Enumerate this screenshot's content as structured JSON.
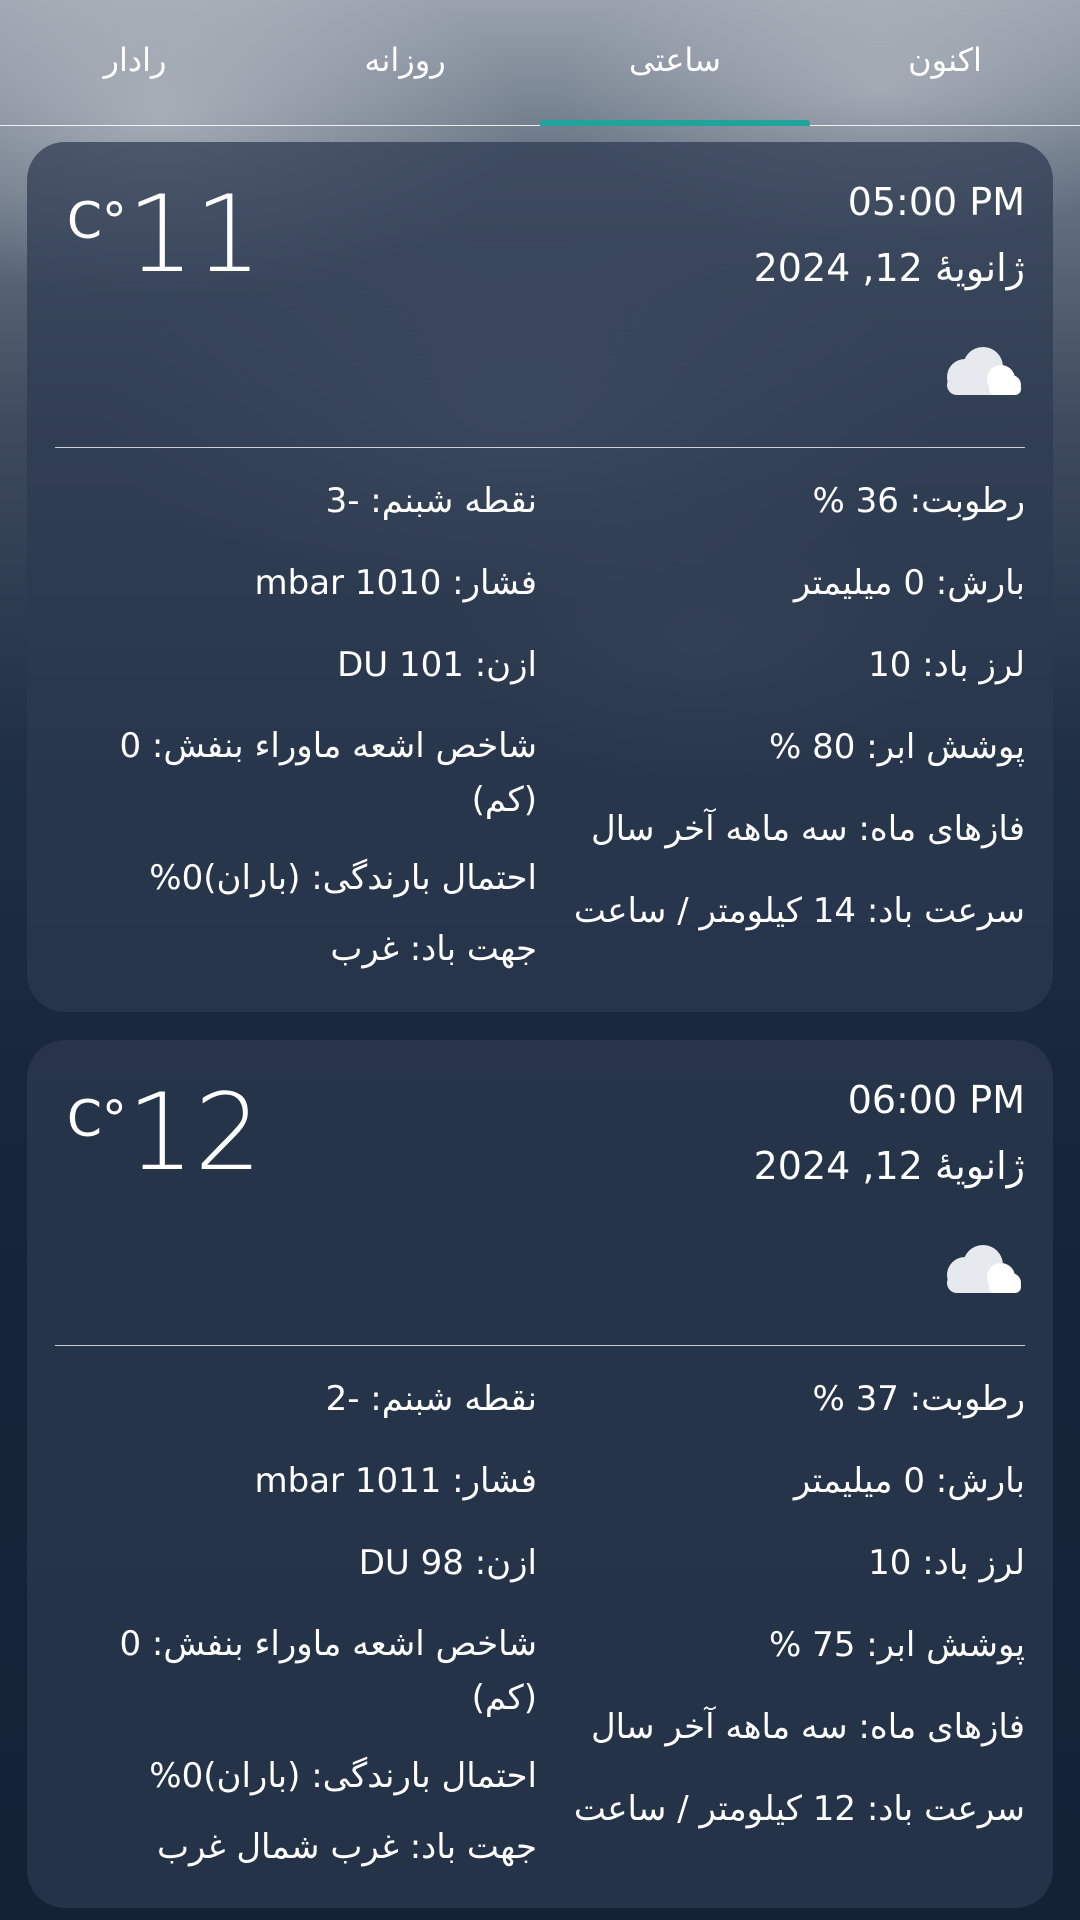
{
  "tabs": [
    {
      "label": "اکنون",
      "active": false
    },
    {
      "label": "ساعتی",
      "active": true
    },
    {
      "label": "روزانه",
      "active": false
    },
    {
      "label": "رادار",
      "active": false
    }
  ],
  "accent_color": "#1fa39a",
  "cards": [
    {
      "time": "05:00 PM",
      "date": "ژانویهٔ 12, 2024",
      "temperature": "11",
      "unit": "C°",
      "icon": "cloud-icon",
      "right_col": [
        "رطوبت: 36 %",
        "بارش: 0 میلیمتر",
        "لرز باد: 10",
        "پوشش ابر: 80 %",
        "فازهای ماه: سه ماهه آخر سال",
        "سرعت باد: 14 کیلومتر / ساعت"
      ],
      "left_col": [
        "نقطه شبنم: -3",
        "فشار: 1010 mbar",
        "ازن: 101 DU",
        "شاخص اشعه ماوراء بنفش: 0 (کم)",
        "احتمال بارندگی: (باران)0%",
        "جهت باد: غرب"
      ]
    },
    {
      "time": "06:00 PM",
      "date": "ژانویهٔ 12, 2024",
      "temperature": "12",
      "unit": "C°",
      "icon": "cloud-icon",
      "right_col": [
        "رطوبت: 37 %",
        "بارش: 0 میلیمتر",
        "لرز باد: 10",
        "پوشش ابر: 75 %",
        "فازهای ماه: سه ماهه آخر سال",
        "سرعت باد: 12 کیلومتر / ساعت"
      ],
      "left_col": [
        "نقطه شبنم: -2",
        "فشار: 1011 mbar",
        "ازن: 98 DU",
        "شاخص اشعه ماوراء بنفش: 0 (کم)",
        "احتمال بارندگی: (باران)0%",
        "جهت باد: غرب شمال غرب"
      ]
    }
  ]
}
